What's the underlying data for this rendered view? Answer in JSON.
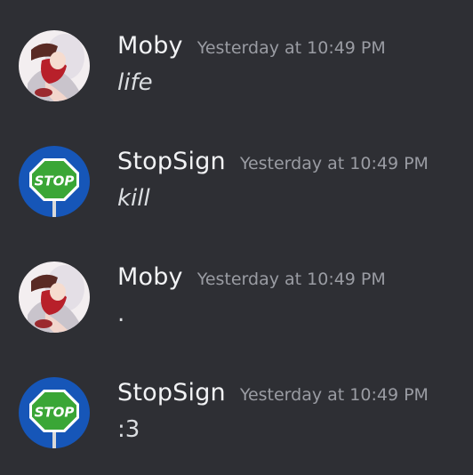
{
  "colors": {
    "background": "#2e2f34",
    "username": "#f2f3f5",
    "timestamp": "#9a9ca3",
    "message_text": "#dbdee1",
    "stop_sign_green": "#3aa636",
    "stop_sign_bg": "#1656b8"
  },
  "messages": [
    {
      "author": "Moby",
      "timestamp": "Yesterday at 10:49 PM",
      "content": "life",
      "avatar_icon": "anime-girl-avatar-icon",
      "italic": true
    },
    {
      "author": "StopSign",
      "timestamp": "Yesterday at 10:49 PM",
      "content": "kill",
      "avatar_icon": "stop-sign-avatar-icon",
      "avatar_text": "STOP",
      "italic": true
    },
    {
      "author": "Moby",
      "timestamp": "Yesterday at 10:49 PM",
      "content": ".",
      "avatar_icon": "anime-girl-avatar-icon",
      "italic": false
    },
    {
      "author": "StopSign",
      "timestamp": "Yesterday at 10:49 PM",
      "content": ":3",
      "avatar_icon": "stop-sign-avatar-icon",
      "avatar_text": "STOP",
      "italic": false
    }
  ]
}
